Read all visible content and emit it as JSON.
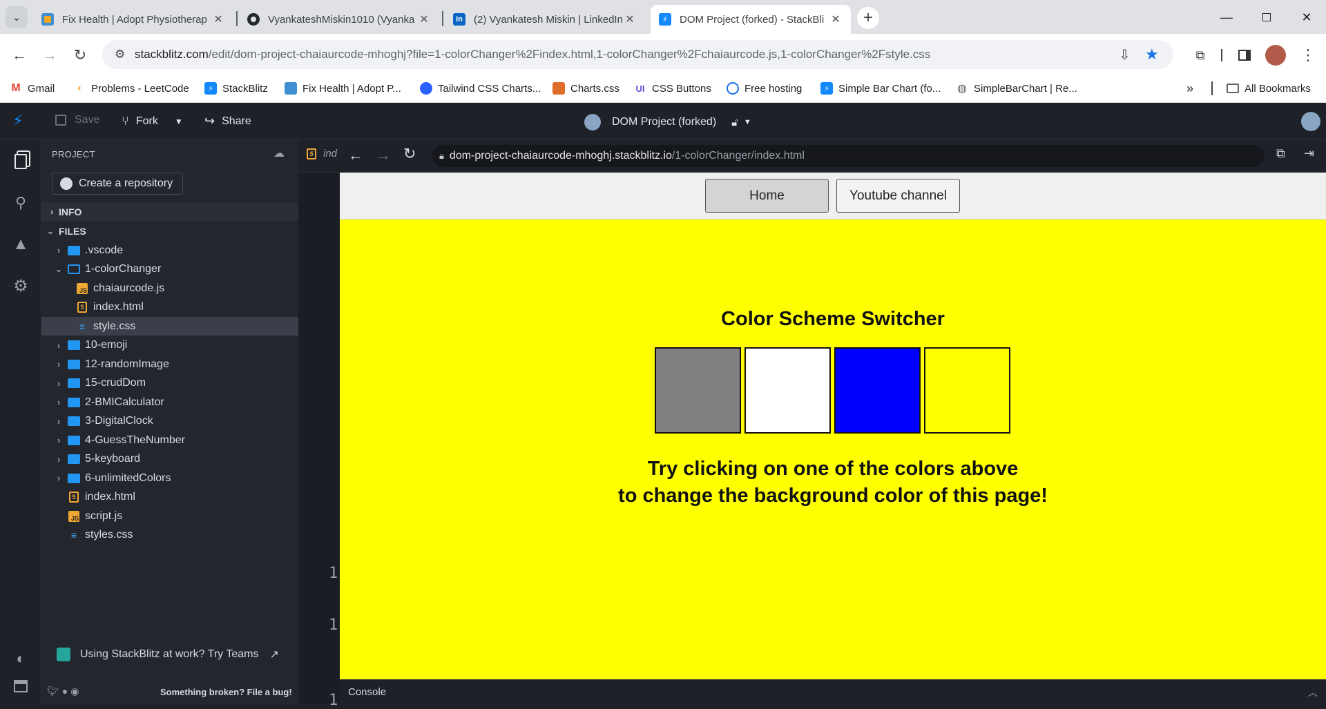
{
  "browser": {
    "tabs": [
      {
        "title": "Fix Health | Adopt Physiotherap",
        "favicon": "fixhealth-icon",
        "active": false
      },
      {
        "title": "VyankateshMiskin1010 (Vyanka",
        "favicon": "github-icon",
        "active": false
      },
      {
        "title": "(2) Vyankatesh Miskin | LinkedIn",
        "favicon": "linkedin-icon",
        "active": false
      },
      {
        "title": "DOM Project (forked) - StackBli",
        "favicon": "stackblitz-icon",
        "active": true
      }
    ],
    "url_host": "stackblitz.com",
    "url_path": "/edit/dom-project-chaiaurcode-mhoghj?file=1-colorChanger%2Findex.html,1-colorChanger%2Fchaiaurcode.js,1-colorChanger%2Fstyle.css",
    "bookmarks": [
      {
        "label": "Gmail",
        "icon": "gmail-icon",
        "color": "#ea4335"
      },
      {
        "label": "Problems - LeetCode",
        "icon": "leetcode-icon",
        "color": "#f89f1b"
      },
      {
        "label": "StackBlitz",
        "icon": "stackblitz-icon",
        "color": "#1389fd"
      },
      {
        "label": "Fix Health | Adopt P...",
        "icon": "fixhealth-icon",
        "color": "#3f8fd2"
      },
      {
        "label": "Tailwind CSS Charts...",
        "icon": "tailwind-icon",
        "color": "#2962ff"
      },
      {
        "label": "Charts.css",
        "icon": "chartscss-icon",
        "color": "#e06c2b"
      },
      {
        "label": "CSS Buttons",
        "icon": "ui-icon",
        "color": "#5b4fd8"
      },
      {
        "label": "Free hosting",
        "icon": "hosting-icon",
        "color": "#1a73e8"
      },
      {
        "label": "Simple Bar Chart (fo...",
        "icon": "stackblitz-icon",
        "color": "#1389fd"
      },
      {
        "label": "SimpleBarChart | Re...",
        "icon": "globe-icon",
        "color": "#5f6368"
      }
    ],
    "all_bookmarks": "All Bookmarks"
  },
  "stackblitz": {
    "save": "Save",
    "fork": "Fork",
    "share": "Share",
    "project_title": "DOM Project (forked)",
    "explorer_title": "PROJECT",
    "create_repo": "Create a repository",
    "info": "INFO",
    "files": "FILES",
    "tree": [
      {
        "name": ".vscode",
        "type": "folder",
        "depth": 0,
        "open": false
      },
      {
        "name": "1-colorChanger",
        "type": "folder",
        "depth": 0,
        "open": true
      },
      {
        "name": "chaiaurcode.js",
        "type": "js",
        "depth": 1
      },
      {
        "name": "index.html",
        "type": "html",
        "depth": 1
      },
      {
        "name": "style.css",
        "type": "css",
        "depth": 1,
        "selected": true
      },
      {
        "name": "10-emoji",
        "type": "folder",
        "depth": 0,
        "open": false
      },
      {
        "name": "12-randomImage",
        "type": "folder",
        "depth": 0,
        "open": false
      },
      {
        "name": "15-crudDom",
        "type": "folder",
        "depth": 0,
        "open": false
      },
      {
        "name": "2-BMICalculator",
        "type": "folder",
        "depth": 0,
        "open": false
      },
      {
        "name": "3-DigitalClock",
        "type": "folder",
        "depth": 0,
        "open": false
      },
      {
        "name": "4-GuessTheNumber",
        "type": "folder",
        "depth": 0,
        "open": false
      },
      {
        "name": "5-keyboard",
        "type": "folder",
        "depth": 0,
        "open": false
      },
      {
        "name": "6-unlimitedColors",
        "type": "folder",
        "depth": 0,
        "open": false
      },
      {
        "name": "index.html",
        "type": "html",
        "depth": 0
      },
      {
        "name": "script.js",
        "type": "js",
        "depth": 0
      },
      {
        "name": "styles.css",
        "type": "css",
        "depth": 0
      }
    ],
    "teams_promo": "Using StackBlitz at work? Try Teams",
    "bug_link": "Something broken? File a bug!",
    "editor_tab": "ind",
    "line_numbers": [
      "1",
      "1",
      "1"
    ],
    "preview_url_host": "dom-project-chaiaurcode-mhoghj.stackblitz.io",
    "preview_url_path": "/1-colorChanger/index.html",
    "console": "Console"
  },
  "preview": {
    "nav": [
      "Home",
      "Youtube channel"
    ],
    "heading": "Color Scheme Switcher",
    "swatches": [
      "grey",
      "white",
      "blue",
      "yellow"
    ],
    "swatch_colors": [
      "#808080",
      "#ffffff",
      "#0000ff",
      "#ffff00"
    ],
    "message_line1": "Try clicking on one of the colors above",
    "message_line2": "to change the background color of this page!",
    "background": "#ffff00"
  }
}
